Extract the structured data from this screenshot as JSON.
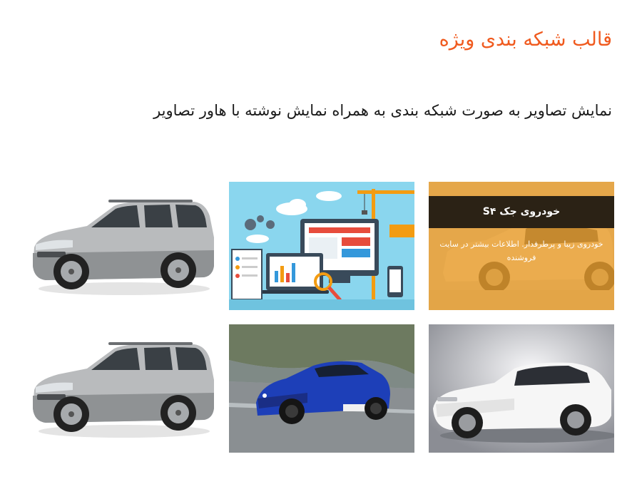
{
  "header": {
    "title": "قالب شبکه بندی ویژه",
    "subtitle": "نمایش تصاویر به صورت شبکه بندی به همراه نمایش نوشته با هاور تصاویر"
  },
  "gallery": {
    "hover_tile": {
      "title": "خودروی جک S۴",
      "description": "خودروی زیبا و پرطرفدار. اطلاعات بیشتر در سایت فروشنده"
    }
  },
  "colors": {
    "accent": "#f05a1e",
    "overlay": "#e89b28",
    "overlay_bar": "#2b2215"
  }
}
